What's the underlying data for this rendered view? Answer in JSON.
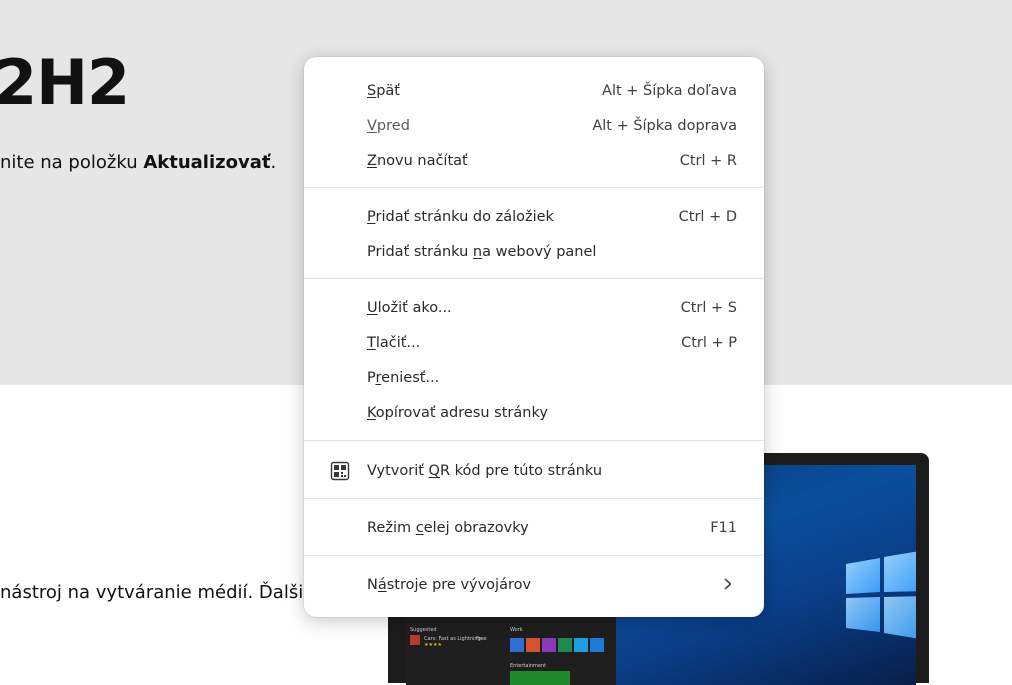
{
  "background": {
    "hero_title": "2H2",
    "hero_text_prefix": "nite na položku ",
    "hero_text_bold": "Aktualizovať",
    "hero_text_suffix": ".",
    "lower_text": "nástroj na vytváranie médií. Ďalšie"
  },
  "laptop": {
    "start_menu": {
      "suggested_label": "Suggested",
      "suggested_app": "Cars: Fast as Lightning",
      "suggested_badge": "Free",
      "work_label": "Work",
      "entertainment_label": "Entertainment"
    }
  },
  "context_menu": {
    "groups": [
      {
        "items": [
          {
            "id": "back",
            "accel": "S",
            "rest": "päť",
            "shortcut": "Alt + Šípka doľava"
          },
          {
            "id": "forward",
            "accel": "V",
            "rest": "pred",
            "shortcut": "Alt + Šípka doprava"
          },
          {
            "id": "reload",
            "accel": "Z",
            "rest": "novu načítať",
            "shortcut": "Ctrl + R"
          }
        ]
      },
      {
        "items": [
          {
            "id": "bookmark",
            "accel": "P",
            "rest": "ridať stránku do záložiek",
            "shortcut": "Ctrl + D"
          },
          {
            "id": "webpanel",
            "pre": "Pridať stránku ",
            "accel": "n",
            "rest": "a webový panel",
            "shortcut": ""
          }
        ]
      },
      {
        "items": [
          {
            "id": "save",
            "accel": "U",
            "rest": "ložiť ako...",
            "shortcut": "Ctrl + S"
          },
          {
            "id": "print",
            "accel": "T",
            "rest": "lačiť...",
            "shortcut": "Ctrl + P"
          },
          {
            "id": "cast",
            "pre": "P",
            "accel": "r",
            "rest": "eniesť...",
            "shortcut": ""
          },
          {
            "id": "copyurl",
            "accel": "K",
            "rest": "opírovať adresu stránky",
            "shortcut": ""
          }
        ]
      },
      {
        "items": [
          {
            "id": "qr",
            "pre": "Vytvoriť ",
            "accel": "Q",
            "rest": "R kód pre túto stránku",
            "shortcut": "",
            "icon": "qr-code-icon"
          }
        ]
      },
      {
        "items": [
          {
            "id": "fullscreen",
            "pre": "Režim ",
            "accel": "c",
            "rest": "elej obrazovky",
            "shortcut": "F11"
          }
        ]
      },
      {
        "items": [
          {
            "id": "devtools",
            "pre": "N",
            "accel": "á",
            "rest": "stroje pre vývojárov",
            "shortcut": "",
            "submenu": true,
            "icon": "chevron-right-icon"
          }
        ]
      }
    ]
  }
}
